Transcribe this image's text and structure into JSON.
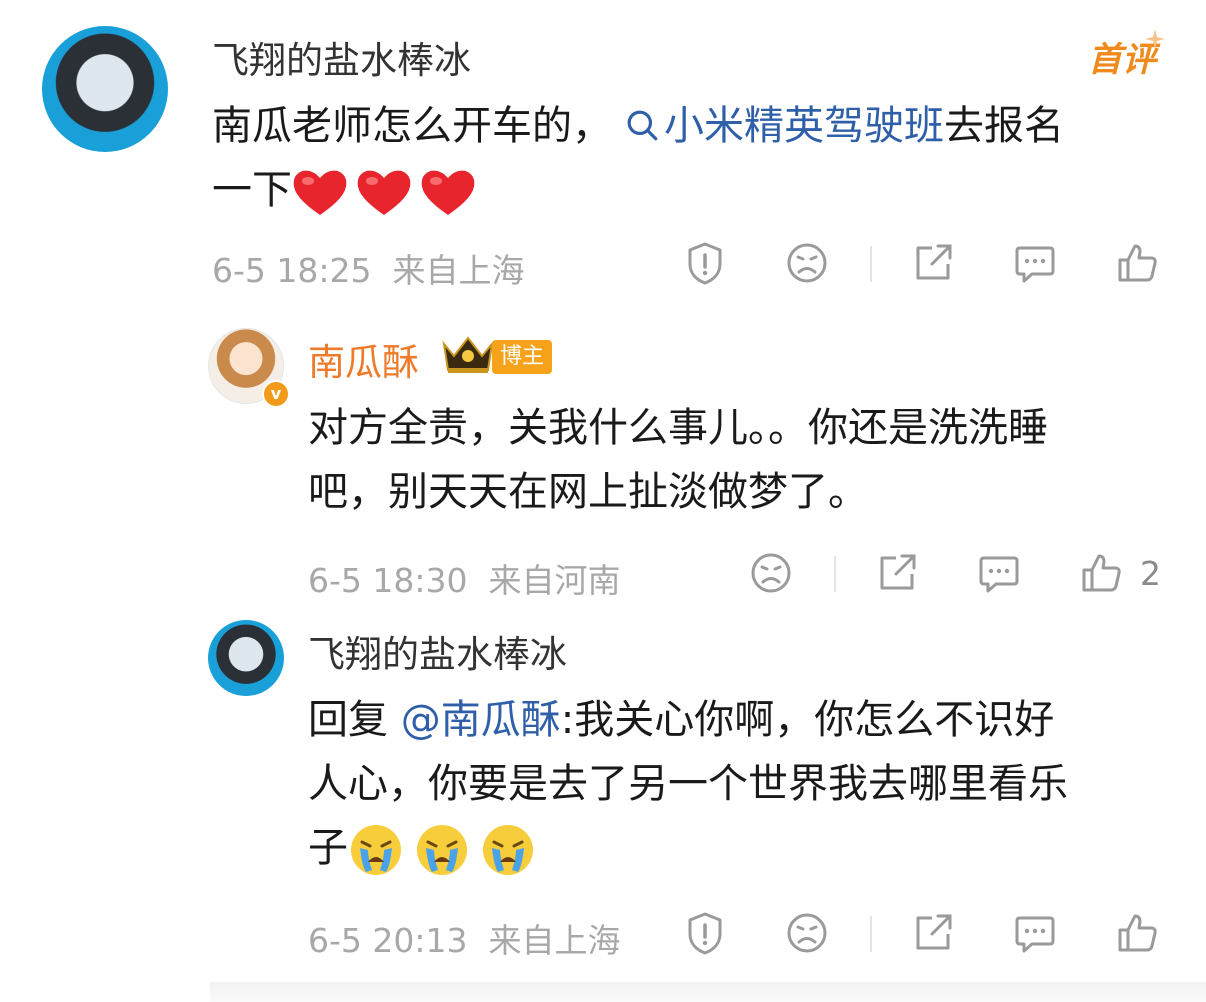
{
  "comments": [
    {
      "username": "飞翔的盐水棒冰",
      "badge": "首评",
      "text_before": "南瓜老师怎么开车的，",
      "link": "小米精英驾驶班",
      "text_after": "去报名",
      "text_line2": "一下",
      "emoji": [
        "red-heart",
        "red-heart",
        "red-heart"
      ],
      "time": "6-5 18:25",
      "location": "来自上海",
      "avatar_icon": "helmet-avatar"
    },
    {
      "username": "南瓜酥",
      "tag": "博主",
      "text_line1": "对方全责，关我什么事儿。。你还是洗洗睡",
      "text_line2": "吧，别天天在网上扯淡做梦了。",
      "time": "6-5 18:30",
      "location": "来自河南",
      "like_count": "2",
      "avatar_icon": "anime-girl-avatar"
    },
    {
      "username": "飞翔的盐水棒冰",
      "reply_prefix": "回复",
      "mention": "@南瓜酥",
      "text_line1": ":我关心你啊，你怎么不识好",
      "text_line2": "人心，你要是去了另一个世界我去哪里看乐",
      "text_line3": "子",
      "emoji": [
        "crying-face",
        "crying-face",
        "crying-face"
      ],
      "time": "6-5 20:13",
      "location": "来自上海",
      "avatar_icon": "helmet-avatar"
    }
  ],
  "colors": {
    "accent_orange": "#ee7a2a",
    "link_blue": "#2f5fa8",
    "heart_red": "#e8252c"
  }
}
